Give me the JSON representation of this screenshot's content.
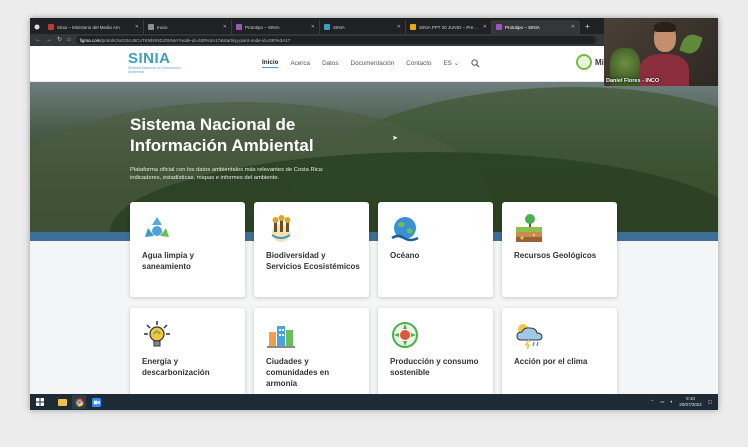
{
  "browser": {
    "tabs": [
      {
        "label": "Sinia – Ministerio del Medio Am",
        "color": "#c0392b",
        "active": false
      },
      {
        "label": "Inicio",
        "color": "#8e8e8e",
        "active": false
      },
      {
        "label": "Prototipo – SINIA",
        "color": "#9b59b6",
        "active": false
      },
      {
        "label": "SINIA",
        "color": "#3d9ec0",
        "active": false
      },
      {
        "label": "SINIA PPT 20 JUNIO – Presenta",
        "color": "#e6a817",
        "active": false
      },
      {
        "label": "Prototipo – SINIA",
        "color": "#9b59b6",
        "active": true
      }
    ],
    "new_tab": "+",
    "url_domain": "figma.com",
    "url_path": "/proto/K3oGOcU5CoTKNhrINDJ/SINIA?node-id=930%3A17&starting-point-node-id=930%3A17"
  },
  "site": {
    "logo_word": "SINIA",
    "logo_sub": "Sistema Nacional de Información Ambiental",
    "menu": [
      "Inicio",
      "Acerca",
      "Datos",
      "Documentación",
      "Contacto"
    ],
    "lang": "ES",
    "partner_logo": "Mi"
  },
  "hero": {
    "title": "Sistema Nacional de Información Ambiental",
    "description": "Plataforma oficial con los datos ambientales más relevantes de Costa Rica: indicadores, estadísticas, mapas e informes del ambiente."
  },
  "cards": [
    {
      "title": "Agua limpia y saneamiento",
      "icon": "water-recycle-icon"
    },
    {
      "title": "Biodiversidad y Servicios Ecosistémicos",
      "icon": "biodiversity-icon"
    },
    {
      "title": "Océano",
      "icon": "ocean-globe-icon"
    },
    {
      "title": "Recursos Geológicos",
      "icon": "geology-icon"
    },
    {
      "title": "Energía y descarbonización",
      "icon": "lightbulb-icon"
    },
    {
      "title": "Ciudades y comunidades en armonía",
      "icon": "city-icon"
    },
    {
      "title": "Producción y consumo sostenible",
      "icon": "production-icon"
    },
    {
      "title": "Acción por el clima",
      "icon": "storm-cloud-icon"
    }
  ],
  "taskbar": {
    "time": "9:10",
    "date": "20/07/2022"
  },
  "webcam": {
    "name": "Daniel Flores - INCO"
  },
  "colors": {
    "brand": "#3d9ec0",
    "band": "#3e6f98"
  }
}
